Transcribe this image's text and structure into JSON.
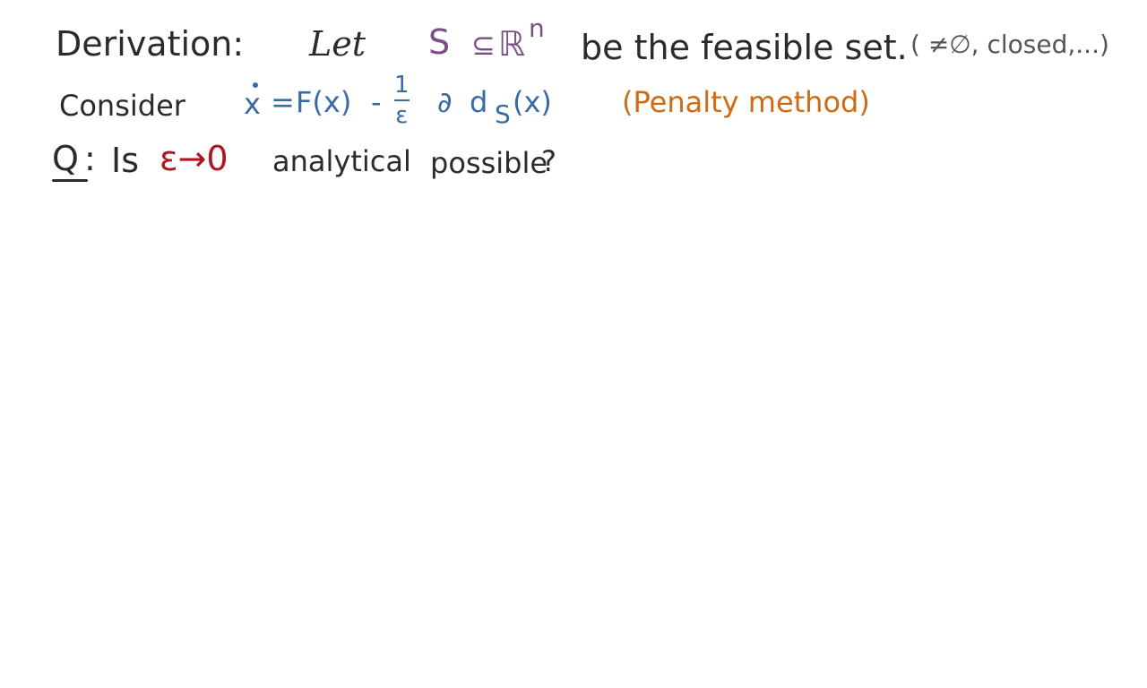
{
  "colors": {
    "ink": "#2b2b2b",
    "purple": "#7a4f86",
    "blue": "#3a6aa6",
    "orange": "#d26a12",
    "red": "#b0161c",
    "gray": "#555555"
  },
  "line1": {
    "label": "Derivation:",
    "let": "Let",
    "set_symbol": "S",
    "subset": "⊆",
    "space": "ℝ",
    "exponent": "n",
    "text": "be the feasible set.",
    "note": "( ≠∅, closed,...)"
  },
  "line2": {
    "label": "Consider",
    "lhs": "x",
    "equals": "=",
    "term1": "F(x)",
    "minus": "-",
    "frac_num": "1",
    "frac_den": "ε",
    "partial": "∂",
    "dist": "d",
    "subscript": "S",
    "arg": "(x)",
    "annotation": "(Penalty method)"
  },
  "line3": {
    "q": "Q",
    "colon": ":",
    "is": "Is",
    "limit": "ε→0",
    "text1": "analytical",
    "text2": "possible",
    "qmark": "?"
  }
}
